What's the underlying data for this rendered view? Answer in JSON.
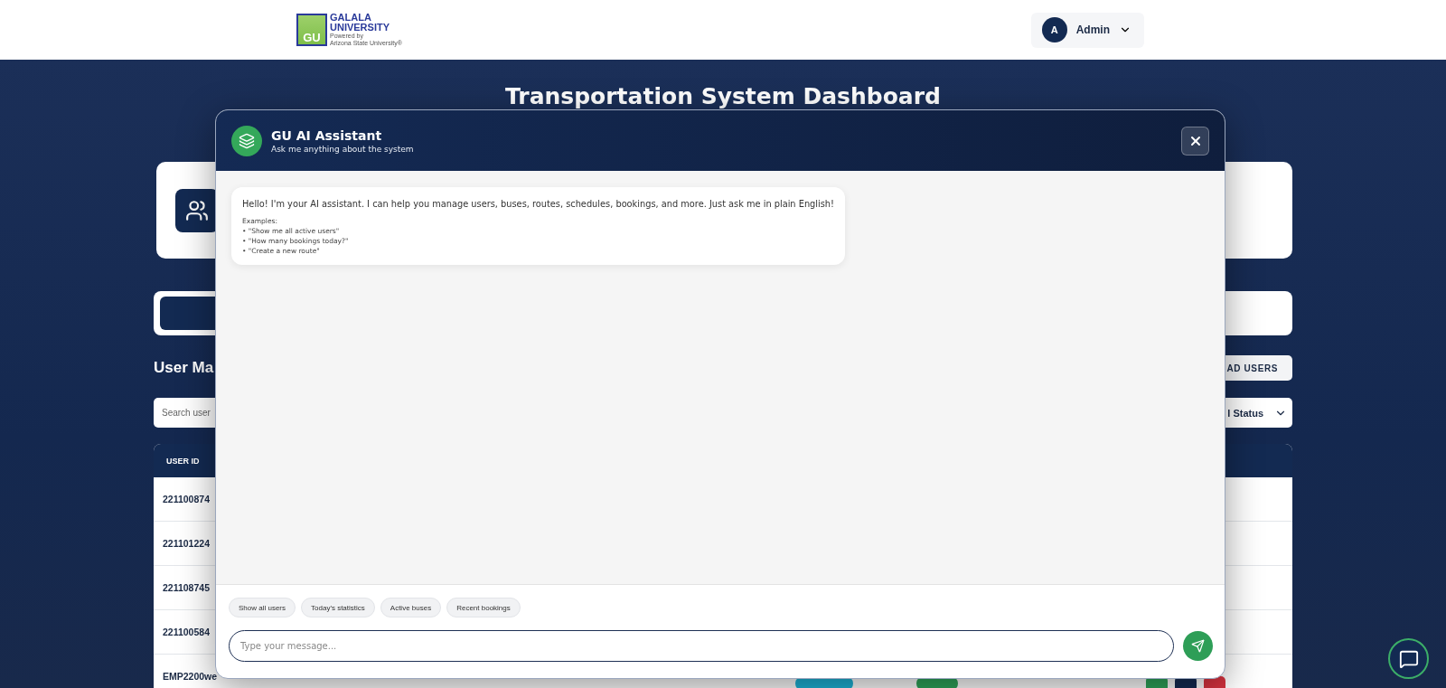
{
  "header": {
    "logo": {
      "line1": "GALALA",
      "line2": "UNIVERSITY",
      "powered": "Powered by",
      "partner": "Arizona State University®",
      "mark": "GU"
    },
    "user": {
      "initial": "A",
      "name": "Admin"
    }
  },
  "page": {
    "title": "Transportation System Dashboard",
    "section_title": "User Ma",
    "upload_button": "AD USERS",
    "search": {
      "placeholder": "Search user"
    },
    "status_filter": "l Status",
    "table": {
      "columns": [
        "USER ID"
      ],
      "rows": [
        {
          "user_id": "221100874"
        },
        {
          "user_id": "221101224"
        },
        {
          "user_id": "221108745"
        },
        {
          "user_id": "221100584"
        },
        {
          "user_id": "EMP2200we"
        }
      ]
    }
  },
  "assistant": {
    "title": "GU AI Assistant",
    "subtitle": "Ask me anything about the system",
    "messages": [
      {
        "text": "Hello! I'm your AI assistant. I can help you manage users, buses, routes, schedules, bookings, and more. Just ask me in plain English!",
        "examples_label": "Examples:",
        "examples": [
          "• \"Show me all active users\"",
          "• \"How many bookings today?\"",
          "• \"Create a new route\""
        ]
      }
    ],
    "suggestions": [
      "Show all users",
      "Today's statistics",
      "Active buses",
      "Recent bookings"
    ],
    "input": {
      "placeholder": "Type your message..."
    }
  }
}
